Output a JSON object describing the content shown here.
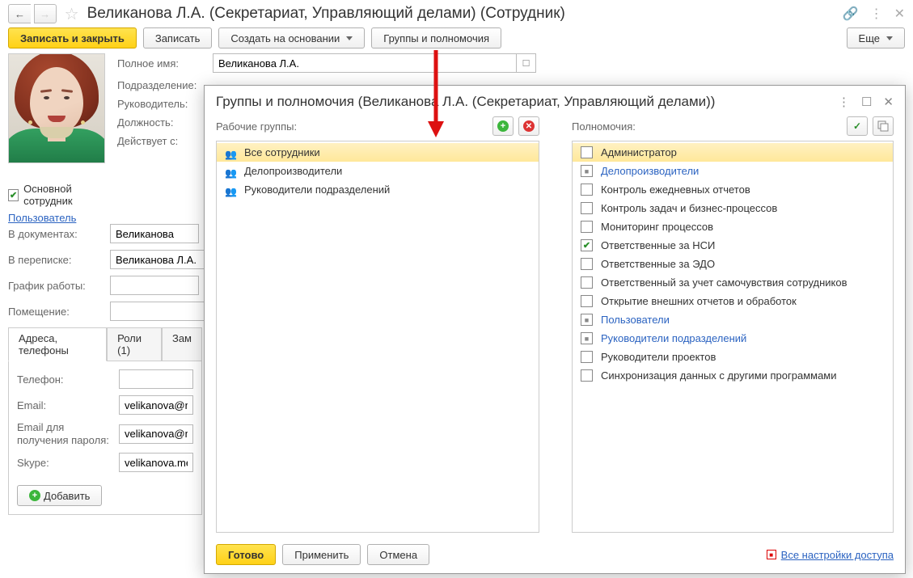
{
  "titlebar": {
    "title": "Великанова Л.А. (Секретариат, Управляющий делами) (Сотрудник)"
  },
  "toolbar": {
    "save_close": "Записать и закрыть",
    "save": "Записать",
    "create_based": "Создать на основании",
    "groups": "Группы и полномочия",
    "more": "Еще"
  },
  "form": {
    "full_name_label": "Полное имя:",
    "full_name_value": "Великанова Л.А.",
    "dept_label": "Подразделение:",
    "manager_label": "Руководитель:",
    "position_label": "Должность:",
    "effective_label": "Действует с:",
    "main_employee": "Основной сотрудник",
    "user_link": "Пользователь",
    "in_docs_label": "В документах:",
    "in_docs_value": "Великанова",
    "in_corr_label": "В переписке:",
    "in_corr_value": "Великанова Л.А.",
    "schedule_label": "График работы:",
    "room_label": "Помещение:"
  },
  "tabs": {
    "t1": "Адреса, телефоны",
    "t2": "Роли (1)",
    "t3": "Зам"
  },
  "contacts": {
    "phone_label": "Телефон:",
    "email_label": "Email:",
    "email_value": "velikanova@mercury",
    "emailpw_label": "Email для получения пароля:",
    "emailpw_value": "velikanova@mercury",
    "skype_label": "Skype:",
    "skype_value": "velikanova.mercury",
    "add": "Добавить"
  },
  "dialog": {
    "title": "Группы и полномочия (Великанова Л.А. (Секретариат, Управляющий делами))",
    "groups_label": "Рабочие группы:",
    "perms_label": "Полномочия:",
    "groups": [
      "Все сотрудники",
      "Делопроизводители",
      "Руководители подразделений"
    ],
    "perms": [
      {
        "label": "Администратор",
        "state": "none",
        "highlight": true,
        "link": false
      },
      {
        "label": "Делопроизводители",
        "state": "partial",
        "link": true
      },
      {
        "label": "Контроль ежедневных отчетов",
        "state": "none",
        "link": false
      },
      {
        "label": "Контроль задач и бизнес-процессов",
        "state": "none",
        "link": false
      },
      {
        "label": "Мониторинг процессов",
        "state": "none",
        "link": false
      },
      {
        "label": "Ответственные за НСИ",
        "state": "checked",
        "link": false
      },
      {
        "label": "Ответственные за ЭДО",
        "state": "none",
        "link": false
      },
      {
        "label": "Ответственный за учет самочувствия сотрудников",
        "state": "none",
        "link": false
      },
      {
        "label": "Открытие внешних отчетов и обработок",
        "state": "none",
        "link": false
      },
      {
        "label": "Пользователи",
        "state": "partial",
        "link": true
      },
      {
        "label": "Руководители подразделений",
        "state": "partial",
        "link": true
      },
      {
        "label": "Руководители проектов",
        "state": "none",
        "link": false
      },
      {
        "label": "Синхронизация данных с другими программами",
        "state": "none",
        "link": false
      }
    ],
    "ready": "Готово",
    "apply": "Применить",
    "cancel": "Отмена",
    "all_settings": "Все настройки доступа"
  }
}
